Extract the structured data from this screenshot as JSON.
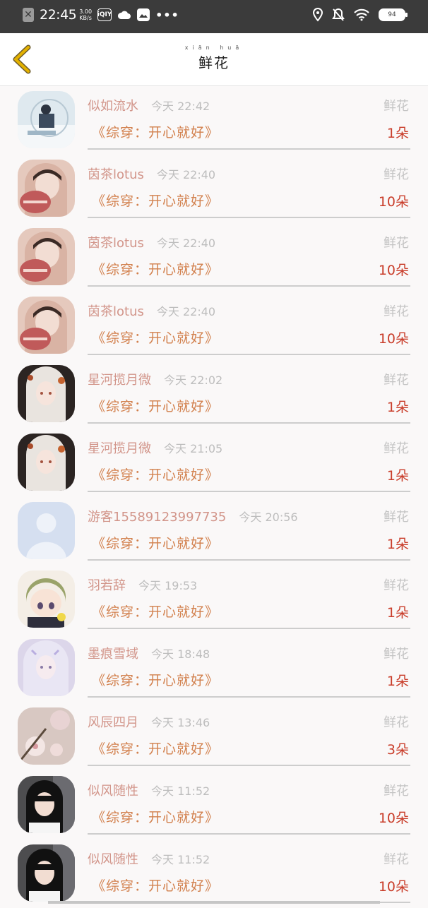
{
  "status_bar": {
    "time": "22:45",
    "speed_value": "3.00",
    "speed_unit": "KB/s",
    "app_icon_text": "iQIY",
    "dots": "•••",
    "battery": "94",
    "icons": [
      "location-icon",
      "bell-off-icon",
      "wifi-icon",
      "battery-icon"
    ]
  },
  "header": {
    "title": "鲜花",
    "title_pinyin": "xiān huā",
    "back_icon": "chevron-left-icon"
  },
  "colors": {
    "username": "#d2958a",
    "book": "#d2804d",
    "count": "#c93d2a",
    "muted": "#bdbdbd",
    "back": "#e3b100"
  },
  "records": [
    {
      "user": "似如流水",
      "day": "今天",
      "time": "22:42",
      "gift": "鲜花",
      "book": "《综穿：开心就好》",
      "count": "1朵",
      "avatar": "winter-scene"
    },
    {
      "user": "茵茶lotus",
      "day": "今天",
      "time": "22:40",
      "gift": "鲜花",
      "book": "《综穿：开心就好》",
      "count": "10朵",
      "avatar": "hood-girl"
    },
    {
      "user": "茵茶lotus",
      "day": "今天",
      "time": "22:40",
      "gift": "鲜花",
      "book": "《综穿：开心就好》",
      "count": "10朵",
      "avatar": "hood-girl"
    },
    {
      "user": "茵茶lotus",
      "day": "今天",
      "time": "22:40",
      "gift": "鲜花",
      "book": "《综穿：开心就好》",
      "count": "10朵",
      "avatar": "hood-girl"
    },
    {
      "user": "星河揽月微",
      "day": "今天",
      "time": "22:02",
      "gift": "鲜花",
      "book": "《综穿：开心就好》",
      "count": "1朵",
      "avatar": "white-hair"
    },
    {
      "user": "星河揽月微",
      "day": "今天",
      "time": "21:05",
      "gift": "鲜花",
      "book": "《综穿：开心就好》",
      "count": "1朵",
      "avatar": "white-hair"
    },
    {
      "user": "游客15589123997735",
      "day": "今天",
      "time": "20:56",
      "gift": "鲜花",
      "book": "《综穿：开心就好》",
      "count": "1朵",
      "avatar": "default"
    },
    {
      "user": "羽若辞",
      "day": "今天",
      "time": "19:53",
      "gift": "鲜花",
      "book": "《综穿：开心就好》",
      "count": "1朵",
      "avatar": "anime-kid"
    },
    {
      "user": "墨痕雪域",
      "day": "今天",
      "time": "18:48",
      "gift": "鲜花",
      "book": "《综穿：开心就好》",
      "count": "1朵",
      "avatar": "pastel-girl"
    },
    {
      "user": "风辰四月",
      "day": "今天",
      "time": "13:46",
      "gift": "鲜花",
      "book": "《综穿：开心就好》",
      "count": "3朵",
      "avatar": "blossom"
    },
    {
      "user": "似风随性",
      "day": "今天",
      "time": "11:52",
      "gift": "鲜花",
      "book": "《综穿：开心就好》",
      "count": "10朵",
      "avatar": "dark-girl"
    },
    {
      "user": "似风随性",
      "day": "今天",
      "time": "11:52",
      "gift": "鲜花",
      "book": "《综穿：开心就好》",
      "count": "10朵",
      "avatar": "dark-girl"
    }
  ]
}
